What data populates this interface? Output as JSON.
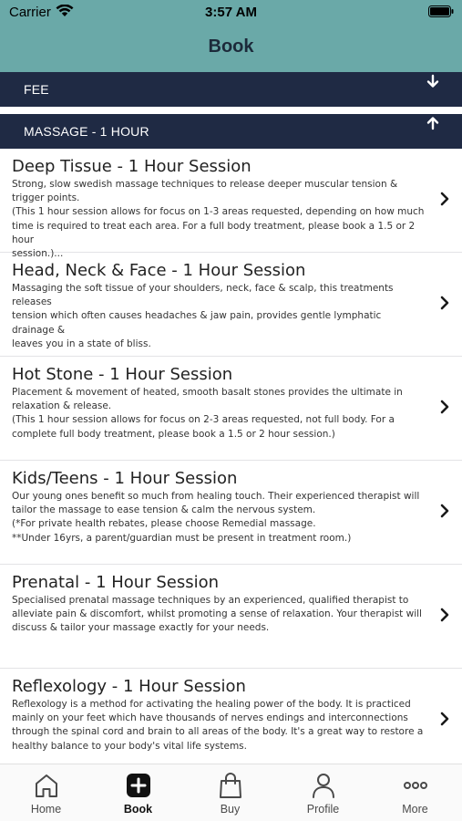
{
  "status": {
    "carrier": "Carrier",
    "time": "3:57 AM"
  },
  "header": {
    "title": "Book"
  },
  "sections": [
    {
      "label": "FEE",
      "state": "collapsed",
      "icon": "arrow-down-icon"
    },
    {
      "label": "MASSAGE - 1 HOUR",
      "state": "expanded",
      "icon": "arrow-up-icon"
    }
  ],
  "services": [
    {
      "title": "Deep Tissue - 1 Hour Session",
      "lines": [
        "Strong, slow swedish massage techniques to release deeper muscular tension &",
        "trigger points.",
        "(This 1 hour session allows for focus on 1-3 areas requested, depending on how much",
        "time is required to treat each area. For a full body treatment, please book a 1.5 or 2 hour",
        "session.)..."
      ]
    },
    {
      "title": "Head, Neck & Face - 1 Hour Session",
      "lines": [
        "Massaging the soft tissue of your shoulders, neck, face & scalp, this treatments releases",
        "tension which often causes headaches & jaw pain, provides gentle lymphatic drainage &",
        "leaves you in a state of bliss."
      ]
    },
    {
      "title": "Hot Stone - 1 Hour Session",
      "lines": [
        "Placement & movement of heated, smooth basalt stones provides the ultimate in",
        "relaxation & release.",
        "(This 1 hour session allows for focus on 2-3 areas requested, not full body. For a",
        "complete full body treatment, please book a 1.5 or 2 hour session.)"
      ]
    },
    {
      "title": "Kids/Teens - 1 Hour Session",
      "lines": [
        "Our young ones benefit so much from healing touch. Their experienced therapist will",
        "tailor the massage to ease tension & calm the nervous system.",
        "(*For private health rebates, please choose Remedial massage.",
        "**Under 16yrs, a parent/guardian must be present in treatment room.)"
      ]
    },
    {
      "title": "Prenatal - 1 Hour Session",
      "lines": [
        "Specialised prenatal massage techniques by an experienced, qualified therapist to",
        "alleviate pain & discomfort, whilst promoting a sense of relaxation. Your therapist will",
        "discuss & tailor your massage exactly for your needs."
      ]
    },
    {
      "title": "Reflexology - 1 Hour Session",
      "lines": [
        "Reflexology is a method for activating the healing power of the body. It is practiced",
        "mainly on your feet which have thousands of nerves endings and interconnections",
        "through the spinal cord and brain to all areas of the body. It's a great way to restore a",
        "healthy balance to your body's vital life systems."
      ]
    }
  ],
  "tabs": [
    {
      "label": "Home",
      "icon": "home-icon"
    },
    {
      "label": "Book",
      "icon": "book-plus-icon",
      "active": true
    },
    {
      "label": "Buy",
      "icon": "shopping-bag-icon"
    },
    {
      "label": "Profile",
      "icon": "person-icon"
    },
    {
      "label": "More",
      "icon": "more-dots-icon"
    }
  ],
  "colors": {
    "header": "#6aa9a8",
    "section_bar": "#1f2a44",
    "tab_active": "#111111"
  }
}
